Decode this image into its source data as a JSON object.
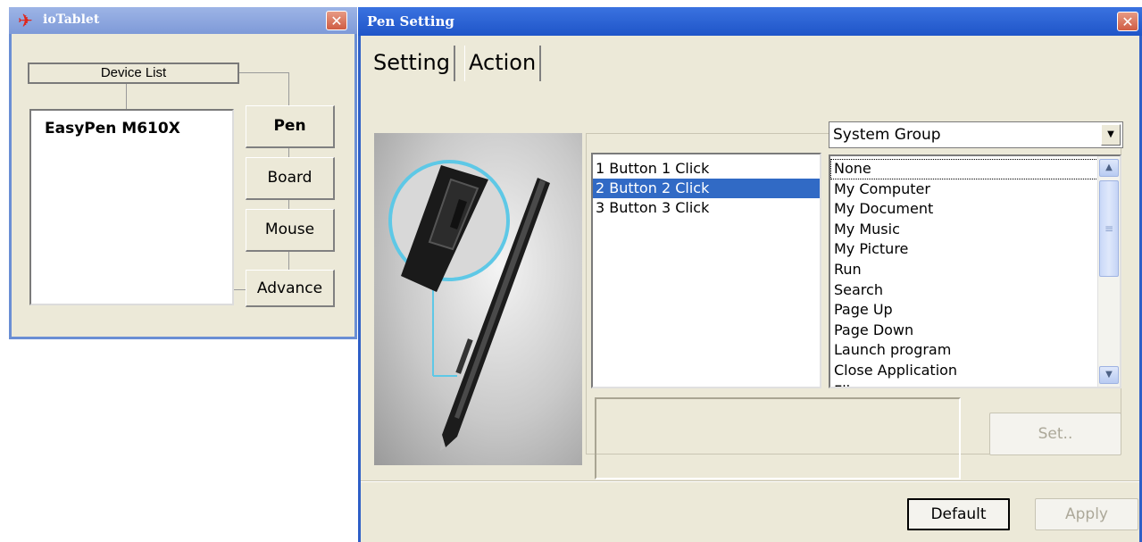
{
  "io_window": {
    "title": "ioTablet",
    "close_glyph": "✕",
    "device_list_label": "Device List",
    "devices": [
      "EasyPen M610X"
    ],
    "nav_buttons": [
      "Pen",
      "Board",
      "Mouse",
      "Advance"
    ]
  },
  "pen_window": {
    "title": "Pen Setting",
    "close_glyph": "✕",
    "tabs": [
      "Setting",
      "Action"
    ],
    "active_tab": "Setting",
    "buttons": [
      {
        "label": "1  Button 1 Click",
        "selected": false
      },
      {
        "label": "2  Button 2 Click",
        "selected": true
      },
      {
        "label": "3  Button 3 Click",
        "selected": false
      }
    ],
    "group_select": {
      "value": "System Group"
    },
    "actions": [
      "None",
      "My Computer",
      "My Document",
      "My Music",
      "My Picture",
      "Run",
      "Search",
      "Page Up",
      "Page Down",
      "Launch program",
      "Close Application",
      "Fli"
    ],
    "focused_action": "None",
    "set_label": "Set..",
    "default_label": "Default",
    "apply_label": "Apply"
  },
  "icons": {
    "app_logo": "tablet-pen-logo-icon",
    "close": "close-icon",
    "dropdown": "chevron-down-icon",
    "scroll_up": "scroll-up-icon",
    "scroll_down": "scroll-down-icon"
  },
  "colors": {
    "window_face": "#ece9d8",
    "pen_titlebar": "#1f55c8",
    "io_titlebar": "#7e9ad8",
    "selection": "#316ac5",
    "close_button": "#cf5c43"
  }
}
